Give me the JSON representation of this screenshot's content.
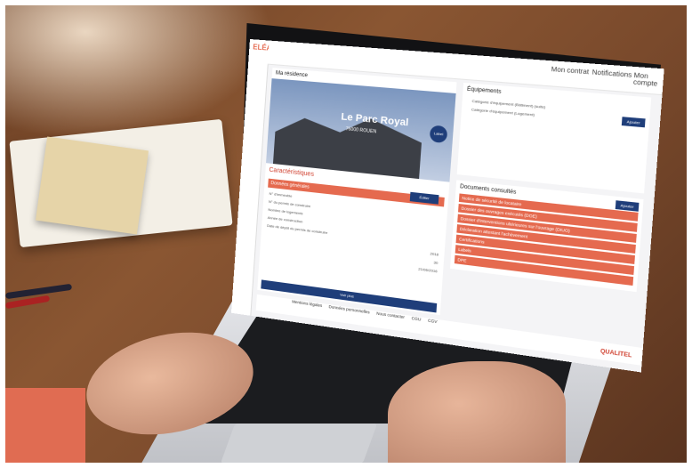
{
  "app": {
    "logo": "ELÉA"
  },
  "topbar": {
    "items": [
      "Mon contrat",
      "Notifications",
      "Mon compte"
    ]
  },
  "residence": {
    "section_title": "Ma résidence",
    "name": "Le Parc Royal",
    "address": "76000 ROUEN",
    "badge": "Label"
  },
  "characteristics": {
    "title": "Caractéristiques",
    "group_label": "Données générales",
    "rows": [
      "N° d'immeuble",
      "N° du permis de construire",
      "Nombre de logements",
      "Année de construction",
      "Date de dépôt du permis de construire"
    ],
    "values": [
      "2018",
      "30",
      "21/06/2016"
    ],
    "action": "Voir plus",
    "edit": "Éditer"
  },
  "equipments": {
    "title": "Équipements",
    "category_a": "Catégorie d'équipement (Bâtiment) (suite)",
    "category_b": "Catégorie d'équipement (Logement)",
    "button": "Ajouter"
  },
  "documents": {
    "title": "Documents consultés",
    "button": "Ajouter",
    "items": [
      "Notice de sécurité de locataire",
      "Dossier des ouvrages exécutés (DOE)",
      "Dossier d'interventions ultérieures sur l'ouvrage (DIUO)",
      "Déclaration attestant l'achèvement",
      "Certifications",
      "Labels",
      "DPE"
    ]
  },
  "footer": {
    "links": [
      "Mentions légales",
      "Données personnelles",
      "Nous contacter",
      "CGU",
      "CGV"
    ],
    "brand": "QUALITEL"
  }
}
